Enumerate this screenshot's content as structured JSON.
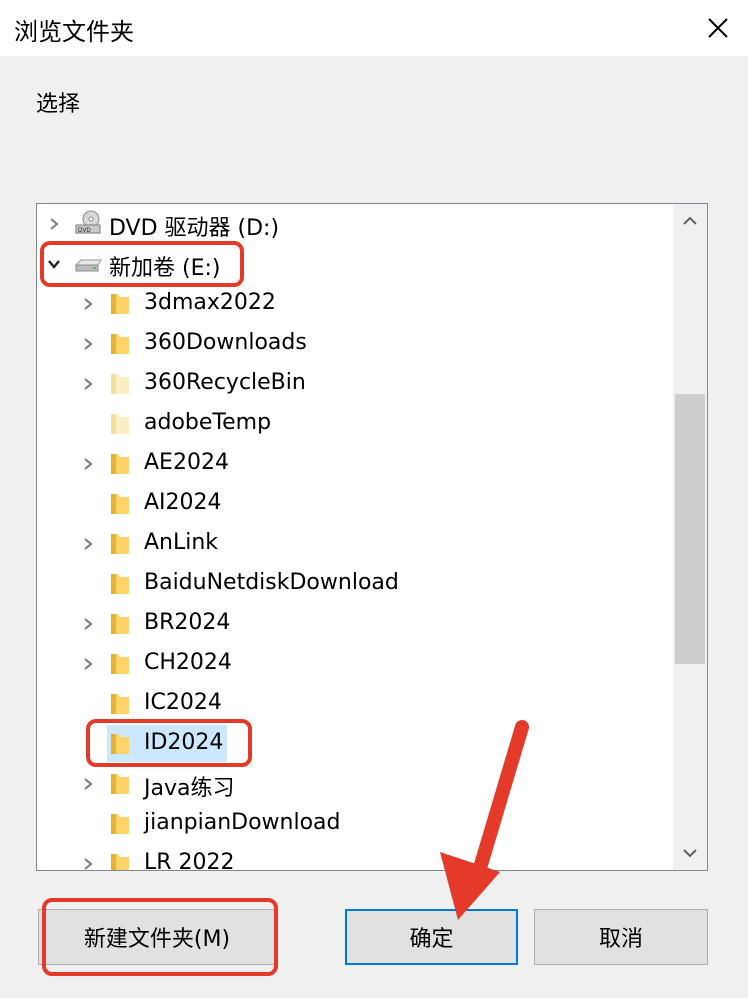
{
  "window": {
    "title": "浏览文件夹",
    "close_icon": "close-icon"
  },
  "prompt": "选择",
  "tree": {
    "items": [
      {
        "label": "DVD 驱动器 (D:)",
        "icon": "dvd-drive-icon",
        "expander": "collapsed",
        "level": 0
      },
      {
        "label": "新加卷 (E:)",
        "icon": "drive-icon",
        "expander": "expanded",
        "level": 0
      },
      {
        "label": "3dmax2022",
        "icon": "folder-icon",
        "expander": "collapsed",
        "level": 1
      },
      {
        "label": "360Downloads",
        "icon": "folder-icon",
        "expander": "collapsed",
        "level": 1
      },
      {
        "label": "360RecycleBin",
        "icon": "folder-icon",
        "expander": "collapsed",
        "level": 1
      },
      {
        "label": "adobeTemp",
        "icon": "folder-icon",
        "expander": "none",
        "level": 1
      },
      {
        "label": "AE2024",
        "icon": "folder-icon",
        "expander": "collapsed",
        "level": 1
      },
      {
        "label": "AI2024",
        "icon": "folder-icon",
        "expander": "none",
        "level": 1
      },
      {
        "label": "AnLink",
        "icon": "folder-icon",
        "expander": "collapsed",
        "level": 1
      },
      {
        "label": "BaiduNetdiskDownload",
        "icon": "folder-icon",
        "expander": "none",
        "level": 1
      },
      {
        "label": "BR2024",
        "icon": "folder-icon",
        "expander": "collapsed",
        "level": 1
      },
      {
        "label": "CH2024",
        "icon": "folder-icon",
        "expander": "collapsed",
        "level": 1
      },
      {
        "label": "IC2024",
        "icon": "folder-icon",
        "expander": "none",
        "level": 1
      },
      {
        "label": "ID2024",
        "icon": "folder-icon",
        "expander": "none",
        "level": 1,
        "selected": true
      },
      {
        "label": "Java练习",
        "icon": "folder-icon",
        "expander": "collapsed",
        "level": 1
      },
      {
        "label": "jianpianDownload",
        "icon": "folder-icon",
        "expander": "none",
        "level": 1
      },
      {
        "label": "LR 2022",
        "icon": "folder-icon",
        "expander": "collapsed",
        "level": 1
      }
    ]
  },
  "buttons": {
    "new_folder": "新建文件夹(M)",
    "ok": "确定",
    "cancel": "取消"
  },
  "colors": {
    "annotation": "#e53a2a",
    "selection": "#cce8ff",
    "primary_border": "#0078d7"
  }
}
